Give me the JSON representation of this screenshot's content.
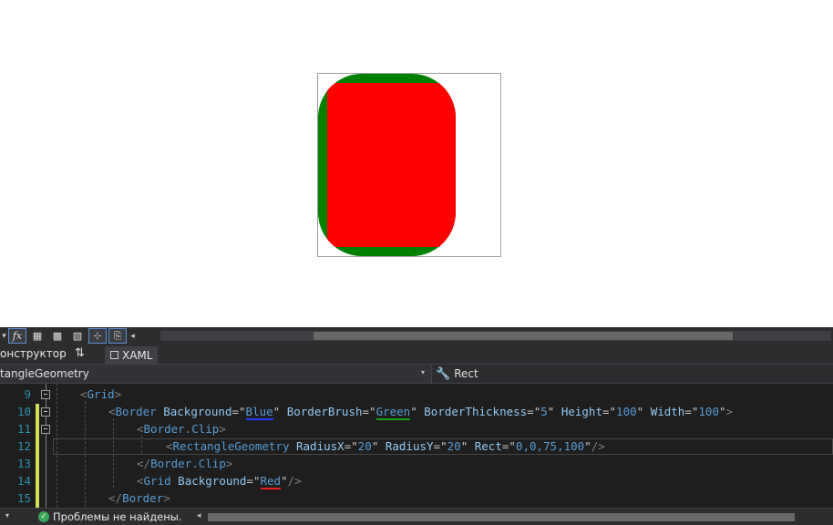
{
  "toolbar": {
    "dropdown_arrow": "▾",
    "buttons": [
      {
        "icon": "formula-icon",
        "glyph": "fx"
      },
      {
        "icon": "grid-icon",
        "glyph": "▦"
      },
      {
        "icon": "snap-grid-icon",
        "glyph": "▩"
      },
      {
        "icon": "checkerboard-icon",
        "glyph": "▧"
      },
      {
        "icon": "snap-lines-icon",
        "glyph": "⊹"
      },
      {
        "icon": "project-code-icon",
        "glyph": "⎘"
      }
    ],
    "scroll_left_arrow": "◂"
  },
  "tabs": {
    "designer_label": "онструктор",
    "swap_glyph": "⇅",
    "xaml_label": "XAML"
  },
  "navbar": {
    "left_value": "tangleGeometry",
    "left_arrow": "▾",
    "wrench_glyph": "🔧",
    "right_value": "Rect"
  },
  "editor": {
    "lines": [
      {
        "num": "9"
      },
      {
        "num": "10"
      },
      {
        "num": "11"
      },
      {
        "num": "12"
      },
      {
        "num": "13"
      },
      {
        "num": "14"
      },
      {
        "num": "15"
      }
    ],
    "tokens": {
      "grid": "Grid",
      "border": "Border",
      "background_attr": "Background",
      "blue": "Blue",
      "borderbrush_attr": "BorderBrush",
      "green": "Green",
      "borderthickness_attr": "BorderThickness",
      "five": "5",
      "height_attr": "Height",
      "hundred": "100",
      "width_attr": "Width",
      "border_clip": "Border.Clip",
      "rect_geom": "RectangleGeometry",
      "radiusx_attr": "RadiusX",
      "twenty": "20",
      "radiusy_attr": "RadiusY",
      "rect_attr": "Rect",
      "rect_val": "0,0,75,100",
      "red": "Red"
    }
  },
  "statusbar": {
    "arrow": "▾",
    "ok_glyph": "✓",
    "message": "Проблемы не найдены.",
    "scroll_left_arrow": "◂"
  },
  "colors": {
    "canvas_green": "#008000",
    "canvas_red": "#ff0000",
    "editor_bg": "#1e1e1e",
    "chrome_bg": "#2d2d30"
  }
}
